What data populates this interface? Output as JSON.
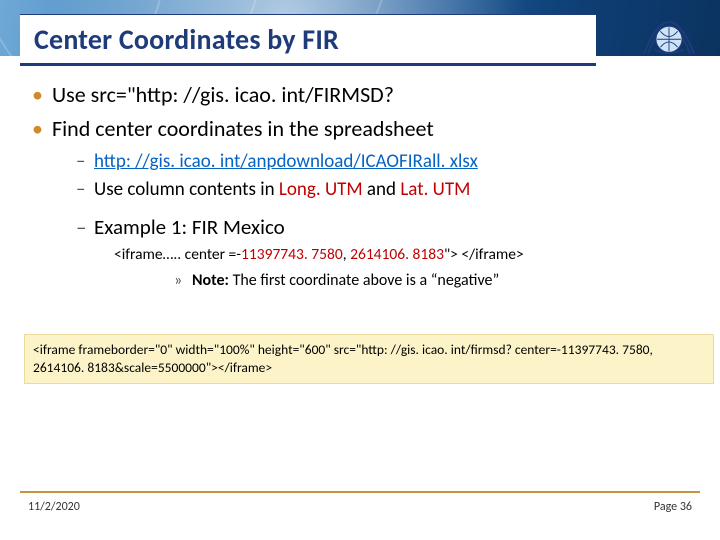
{
  "header": {
    "title": "Center Coordinates by FIR"
  },
  "bullets": {
    "b1": "Use src=\"http: //gis. icao. int/FIRMSD?",
    "b2": "Find center coordinates in the spreadsheet",
    "s1_link": "http: //gis. icao. int/anpdownload/ICAOFIRall. xlsx",
    "s2_pre": "Use column contents in ",
    "s2_long": "Long. UTM",
    "s2_mid": " and ",
    "s2_lat": "Lat. UTM",
    "ex_head": "Example 1: FIR Mexico",
    "ex_code_pre": "<iframe….. center =-",
    "ex_code_n1": "11397743. 7580",
    "ex_code_sep": ", ",
    "ex_code_n2": "2614106. 8183",
    "ex_code_post": "\"> </iframe>",
    "note_pre": "Note: ",
    "note_rest": "The first coordinate above is a “negative”"
  },
  "codebox": "<iframe frameborder=\"0\" width=\"100%\" height=\"600\" src=\"http: //gis. icao. int/firmsd? center=-11397743. 7580, 2614106. 8183&scale=5500000\"></iframe>",
  "footer": {
    "date": "11/2/2020",
    "page": "Page 36"
  }
}
